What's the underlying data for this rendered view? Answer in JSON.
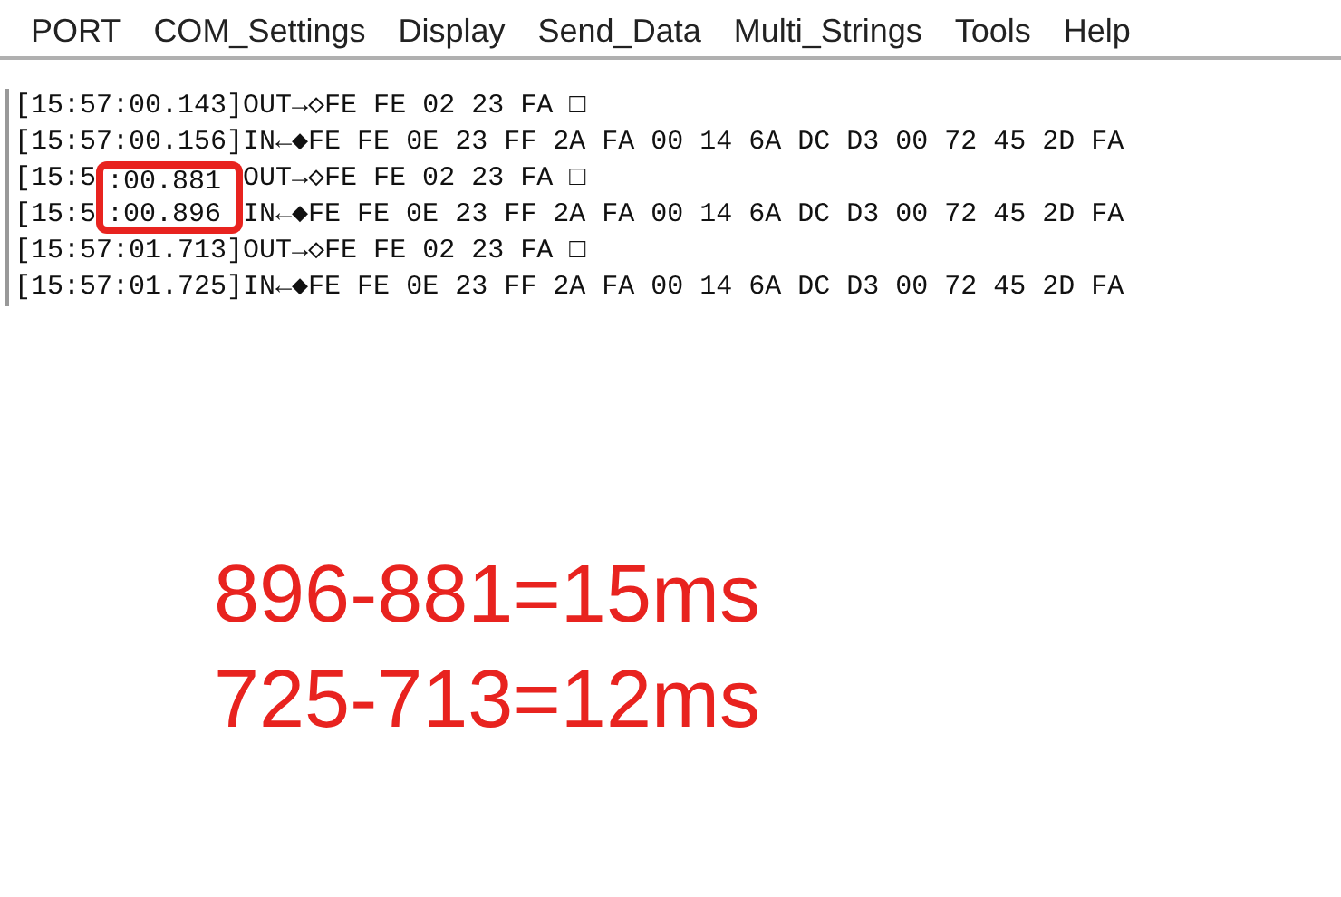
{
  "menu": [
    "PORT",
    "COM_Settings",
    "Display",
    "Send_Data",
    "Multi_Strings",
    "Tools",
    "Help"
  ],
  "log": [
    {
      "text": "[15:57:00.143]OUT→◇FE FE 02 23 FA □",
      "highlighted": false
    },
    {
      "text": "[15:57:00.156]IN←◆FE FE 0E 23 FF 2A FA 00 14 6A DC D3 00 72 45 2D FA",
      "highlighted": false
    },
    {
      "prefix": "[15:5",
      "boxed": ":00.881",
      "text": "OUT→◇FE FE 02 23 FA □",
      "highlighted": true
    },
    {
      "prefix": "[15:5",
      "boxed": ":00.896",
      "text": "IN←◆FE FE 0E 23 FF 2A FA 00 14 6A DC D3 00 72 45 2D FA",
      "highlighted": true
    },
    {
      "text": "[15:57:01.713]OUT→◇FE FE 02 23 FA □",
      "highlighted": false
    },
    {
      "text": "[15:57:01.725]IN←◆FE FE 0E 23 FF 2A FA 00 14 6A DC D3 00 72 45 2D FA",
      "highlighted": false
    }
  ],
  "notes": [
    "896-881=15ms",
    "725-713=12ms"
  ]
}
